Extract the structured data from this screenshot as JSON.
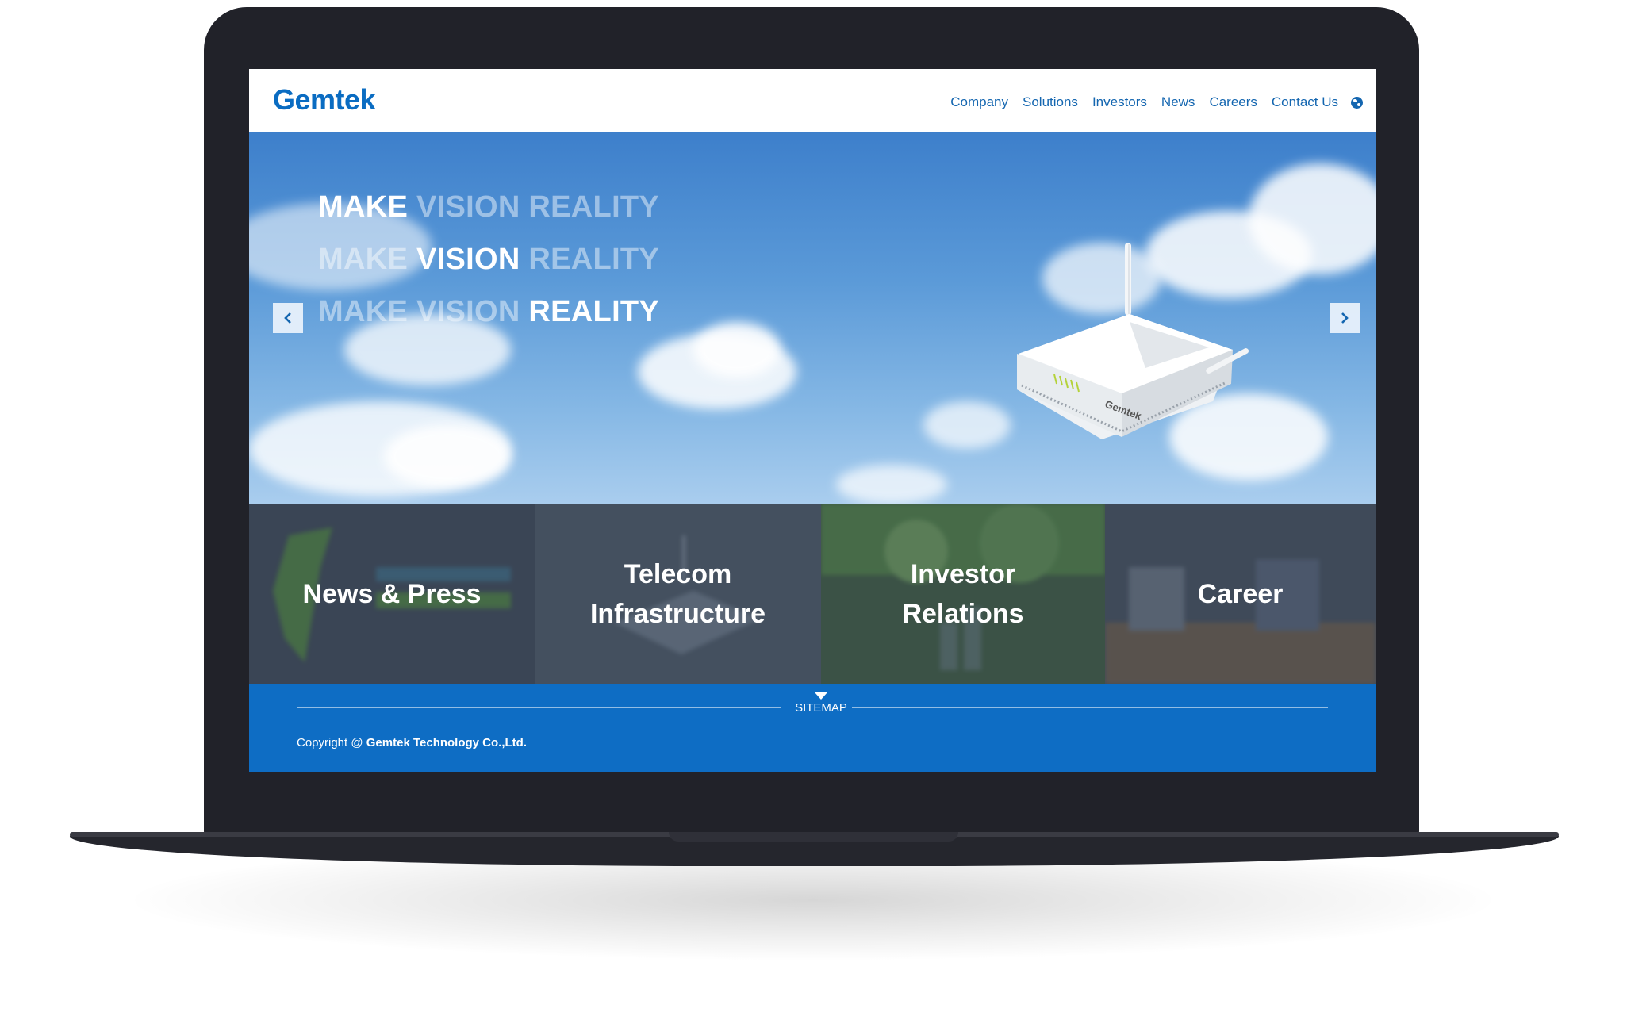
{
  "header": {
    "logo_text": "Gemtek",
    "nav": [
      {
        "label": "Company"
      },
      {
        "label": "Solutions"
      },
      {
        "label": "Investors"
      },
      {
        "label": "News"
      },
      {
        "label": "Careers"
      },
      {
        "label": "Contact Us"
      }
    ],
    "language_icon": "globe-icon"
  },
  "hero": {
    "slogan_lines": [
      {
        "a": "MAKE",
        "b": "VISION",
        "c": "REALITY",
        "highlight": "a"
      },
      {
        "a": "MAKE",
        "b": "VISION",
        "c": "REALITY",
        "highlight": "b"
      },
      {
        "a": "MAKE",
        "b": "VISION",
        "c": "REALITY",
        "highlight": "c"
      }
    ],
    "prev_icon": "chevron-left-icon",
    "next_icon": "chevron-right-icon",
    "router_brand": "Gemtek"
  },
  "tiles": {
    "news": "News & Press",
    "telecom_line1": "Telecom",
    "telecom_line2": "Infrastructure",
    "investor_line1": "Investor",
    "investor_line2": "Relations",
    "career": "Career"
  },
  "footer": {
    "sitemap_label": "SITEMAP",
    "copyright_prefix": "Copyright @ ",
    "company": "Gemtek Technology Co.,Ltd."
  },
  "colors": {
    "brand_blue": "#0a6cc2",
    "footer_blue": "#0e6dc4",
    "laptop_body": "#212229"
  }
}
